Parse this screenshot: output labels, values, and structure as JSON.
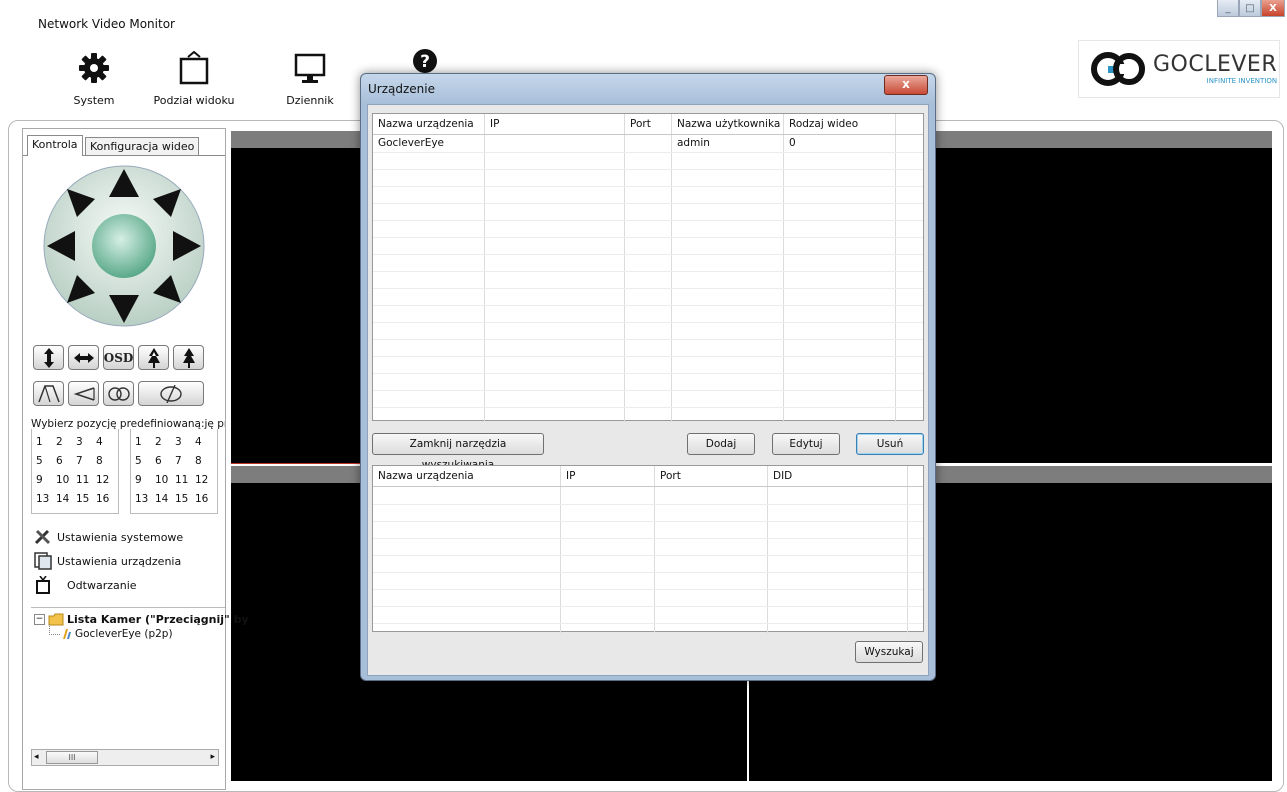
{
  "window": {
    "title": "Network Video Monitor"
  },
  "toolbar": {
    "system_label": "System",
    "split_view_label": "Podział widoku",
    "log_label": "Dziennik"
  },
  "logo": {
    "name": "GOCLEVER",
    "tagline": "INFINITE INVENTION"
  },
  "left_panel": {
    "tabs": [
      "Kontrola",
      "Konfiguracja wideo"
    ],
    "osd_label": "OSD",
    "preset_title": "Wybierz pozycję predefiniowaną:ję pre",
    "presets_a": [
      "1",
      "2",
      "3",
      "4",
      "5",
      "6",
      "7",
      "8",
      "9",
      "10",
      "11",
      "12",
      "13",
      "14",
      "15",
      "16"
    ],
    "presets_b": [
      "1",
      "2",
      "3",
      "4",
      "5",
      "6",
      "7",
      "8",
      "9",
      "10",
      "11",
      "12",
      "13",
      "14",
      "15",
      "16"
    ],
    "menu": {
      "system_settings": "Ustawienia systemowe",
      "device_settings": "Ustawienia urządzenia",
      "playback": "Odtwarzanie"
    },
    "tree": {
      "root": "Lista Kamer (\"Przeciągnij\" by",
      "child": "GocleverEye (p2p)"
    },
    "scroll_grip": "III"
  },
  "dialog": {
    "title": "Urządzenie",
    "close": "x",
    "device_table": {
      "columns": [
        "Nazwa urządzenia",
        "IP",
        "Port",
        "Nazwa użytkownika",
        "Rodzaj wideo"
      ],
      "rows": [
        [
          "GocleverEye",
          "",
          "",
          "admin",
          "0"
        ]
      ]
    },
    "buttons": {
      "close_search": "Zamknij narzędzia wyszukiwania",
      "add": "Dodaj",
      "edit": "Edytuj",
      "remove": "Usuń",
      "search": "Wyszukaj"
    },
    "search_table": {
      "columns": [
        "Nazwa urządzenia",
        "IP",
        "Port",
        "DID"
      ],
      "rows": []
    }
  },
  "colors": {
    "accent": "#2e95c8",
    "video_bg": "#000000",
    "tile_selected": "#c0302a"
  }
}
